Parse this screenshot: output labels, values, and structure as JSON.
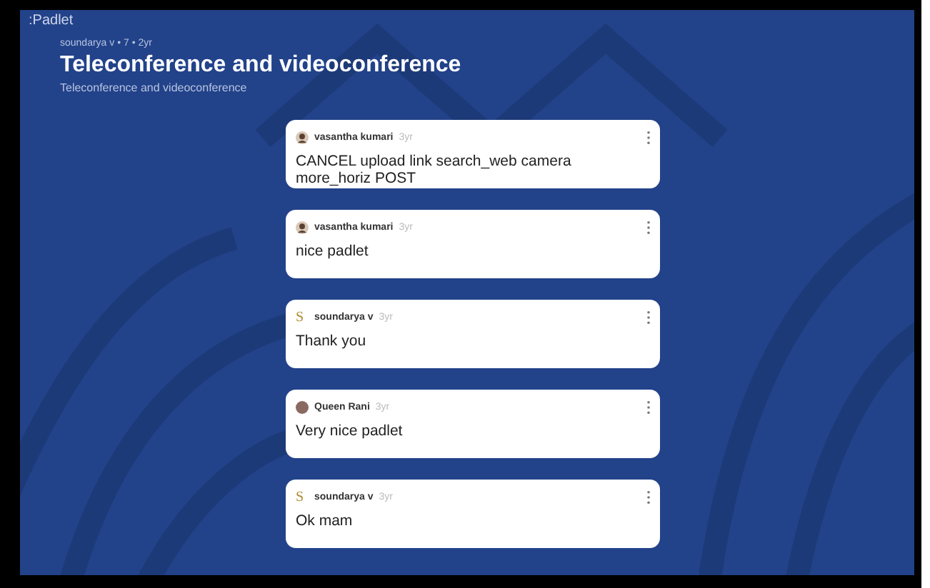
{
  "app": {
    "logo": ":Padlet"
  },
  "header": {
    "meta": "soundarya v • 7 • 2yr",
    "title": "Teleconference and videoconference",
    "description": "Teleconference and videoconference"
  },
  "posts": [
    {
      "author": "vasantha kumari",
      "age": "3yr",
      "body": "CANCEL upload link search_web camera more_horiz POST",
      "avatar": {
        "kind": "photo"
      }
    },
    {
      "author": "vasantha kumari",
      "age": "3yr",
      "body": "nice padlet",
      "avatar": {
        "kind": "photo"
      }
    },
    {
      "author": "soundarya v",
      "age": "3yr",
      "body": "Thank you",
      "avatar": {
        "kind": "letter",
        "letter": "S"
      }
    },
    {
      "author": "Queen Rani",
      "age": "3yr",
      "body": "Very nice padlet",
      "avatar": {
        "kind": "disc"
      }
    },
    {
      "author": "soundarya v",
      "age": "3yr",
      "body": "Ok mam",
      "avatar": {
        "kind": "letter",
        "letter": "S"
      }
    }
  ]
}
